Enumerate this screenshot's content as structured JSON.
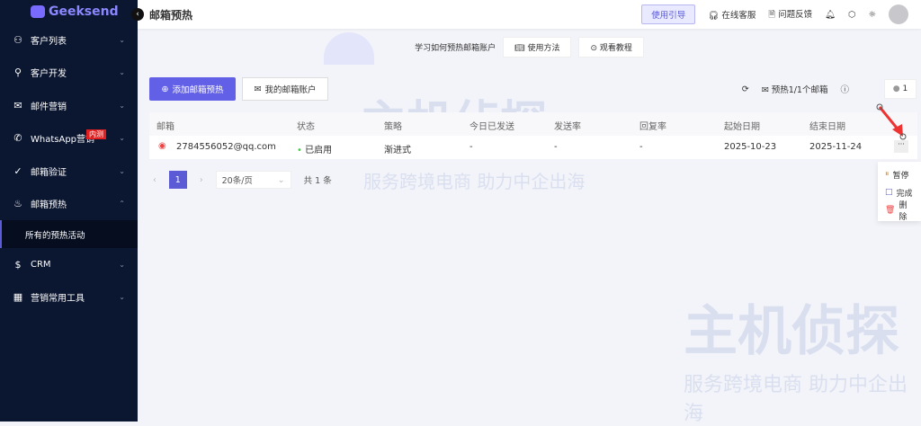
{
  "app": {
    "logo": "Geeksend",
    "page_title": "邮箱预热"
  },
  "sidebar": {
    "items": [
      {
        "label": "客户列表",
        "icon": "user-icon"
      },
      {
        "label": "客户开发",
        "icon": "search-icon"
      },
      {
        "label": "邮件营销",
        "icon": "mail-icon"
      },
      {
        "label": "WhatsApp营销",
        "icon": "whatsapp-icon",
        "badge": "内测"
      },
      {
        "label": "邮箱验证",
        "icon": "check-circle-icon"
      },
      {
        "label": "邮箱预热",
        "icon": "flame-icon"
      },
      {
        "label": "CRM",
        "icon": "dollar-icon"
      },
      {
        "label": "营销常用工具",
        "icon": "grid-icon"
      }
    ],
    "sub_item": "所有的预热活动"
  },
  "topbar": {
    "guide": "使用引导",
    "support": "在线客服",
    "feedback": "问题反馈"
  },
  "banner": {
    "text": "学习如何预热邮箱账户",
    "method": "使用方法",
    "tutorial": "观看教程"
  },
  "actions": {
    "add": "添加邮箱预热",
    "my_accounts": "我的邮箱账户",
    "warmup_count": "预热1/1个邮箱",
    "online_count": "1"
  },
  "table": {
    "headers": [
      "邮箱",
      "状态",
      "策略",
      "今日已发送",
      "发送率",
      "回复率",
      "起始日期",
      "结束日期"
    ],
    "rows": [
      [
        "2784556052@qq.com",
        "已启用",
        "渐进式",
        "-",
        "-",
        "-",
        "2025-10-23",
        "2025-11-24"
      ]
    ]
  },
  "menu": [
    "暂停",
    "完成",
    "删除"
  ],
  "pager": {
    "page": "1",
    "size": "20条/页",
    "total": "共 1 条"
  },
  "watermark": {
    "brand": "主机侦探",
    "slogan": "服务跨境电商 助力中企出海"
  }
}
